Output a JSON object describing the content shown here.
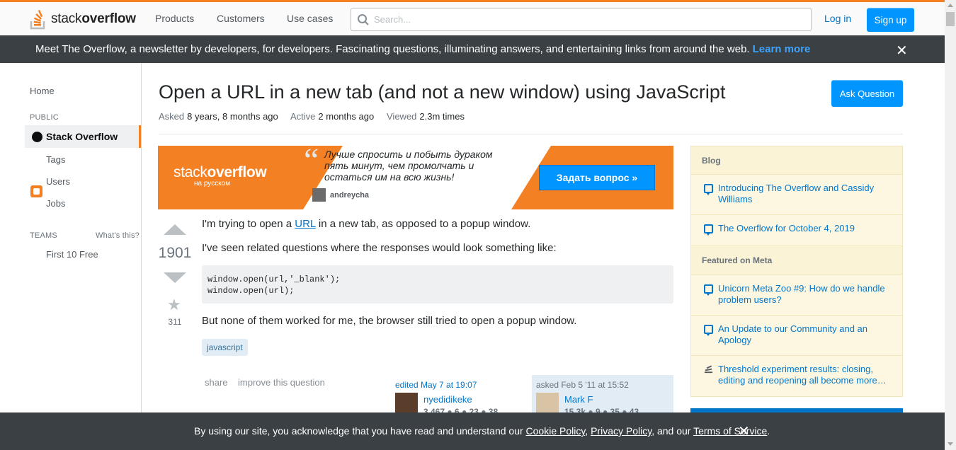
{
  "header": {
    "logo_text_light": "stack",
    "logo_text_bold": "overflow",
    "nav": [
      "Products",
      "Customers",
      "Use cases"
    ],
    "search_placeholder": "Search...",
    "login_label": "Log in",
    "signup_label": "Sign up"
  },
  "newsletter": {
    "message": "Meet The Overflow, a newsletter by developers, for developers. Fascinating questions, illuminating answers, and entertaining links from around the web.",
    "link_label": "Learn more",
    "close": "✕"
  },
  "sidebar": {
    "home": "Home",
    "public_heading": "PUBLIC",
    "active_item": "Stack Overflow",
    "items": [
      "Tags",
      "Users",
      "Jobs"
    ],
    "teams_heading": "TEAMS",
    "whats_this": "What's this?",
    "teams_item": "First 10 Free"
  },
  "question": {
    "title": "Open a URL in a new tab (and not a new window) using JavaScript",
    "ask_button": "Ask Question",
    "asked_label": "Asked",
    "asked_value": "8 years, 8 months ago",
    "active_label": "Active",
    "active_value": "2 months ago",
    "viewed_label": "Viewed",
    "viewed_value": "2.3m times",
    "votes": "1901",
    "favorites": "311",
    "para1_before": "I'm trying to open a ",
    "para1_link": "URL",
    "para1_after": " in a new tab, as opposed to a popup window.",
    "para2": "I've seen related questions where the responses would look something like:",
    "code_line1": "window.open(url,'_blank');",
    "code_line2": "window.open(url);",
    "para3": "But none of them worked for me, the browser still tried to open a popup window.",
    "tag": "javascript",
    "menu_share": "share",
    "menu_improve": "improve this question",
    "edited_when": "edited May 7 at 19:07",
    "editor_name": "nyedidikeke",
    "editor_rep": "3,467 ● 6 ● 23 ● 38",
    "asked_when": "asked Feb 5 '11 at 15:52",
    "asker_name": "Mark F",
    "asker_rep": "15.3k ● 9 ● 35 ● 43"
  },
  "ad": {
    "logo_light": "stack",
    "logo_bold": "overflow",
    "logo_sub": "на русском",
    "quote": "Лучше спросить и побыть дураком пять минут, чем промолчать и остаться им на всю жизнь!",
    "user": "andreycha",
    "cta": "Задать вопрос »"
  },
  "right_sidebar": {
    "blog_heading": "Blog",
    "blog_items": [
      "Introducing The Overflow and Cassidy Williams",
      "The Overflow for October 4, 2019"
    ],
    "meta_heading": "Featured on Meta",
    "meta_items": [
      "Unicorn Meta Zoo #9: How do we handle problem users?",
      "An Update to our Community and an Apology",
      "Threshold experiment results: closing, editing and reopening all become more…"
    ]
  },
  "cookie": {
    "before": "By using our site, you acknowledge that you have read and understand our ",
    "cookie_policy": "Cookie Policy",
    "sep1": ", ",
    "privacy_policy": "Privacy Policy",
    "sep2": ", and our ",
    "terms": "Terms of Service",
    "end": ".",
    "close": "✕"
  },
  "colors": {
    "accent_orange": "#f48024",
    "link_blue": "#0077cc",
    "button_blue": "#0095ff",
    "dark_bar": "#3b4045",
    "widget_yellow": "#fdf7e2"
  }
}
